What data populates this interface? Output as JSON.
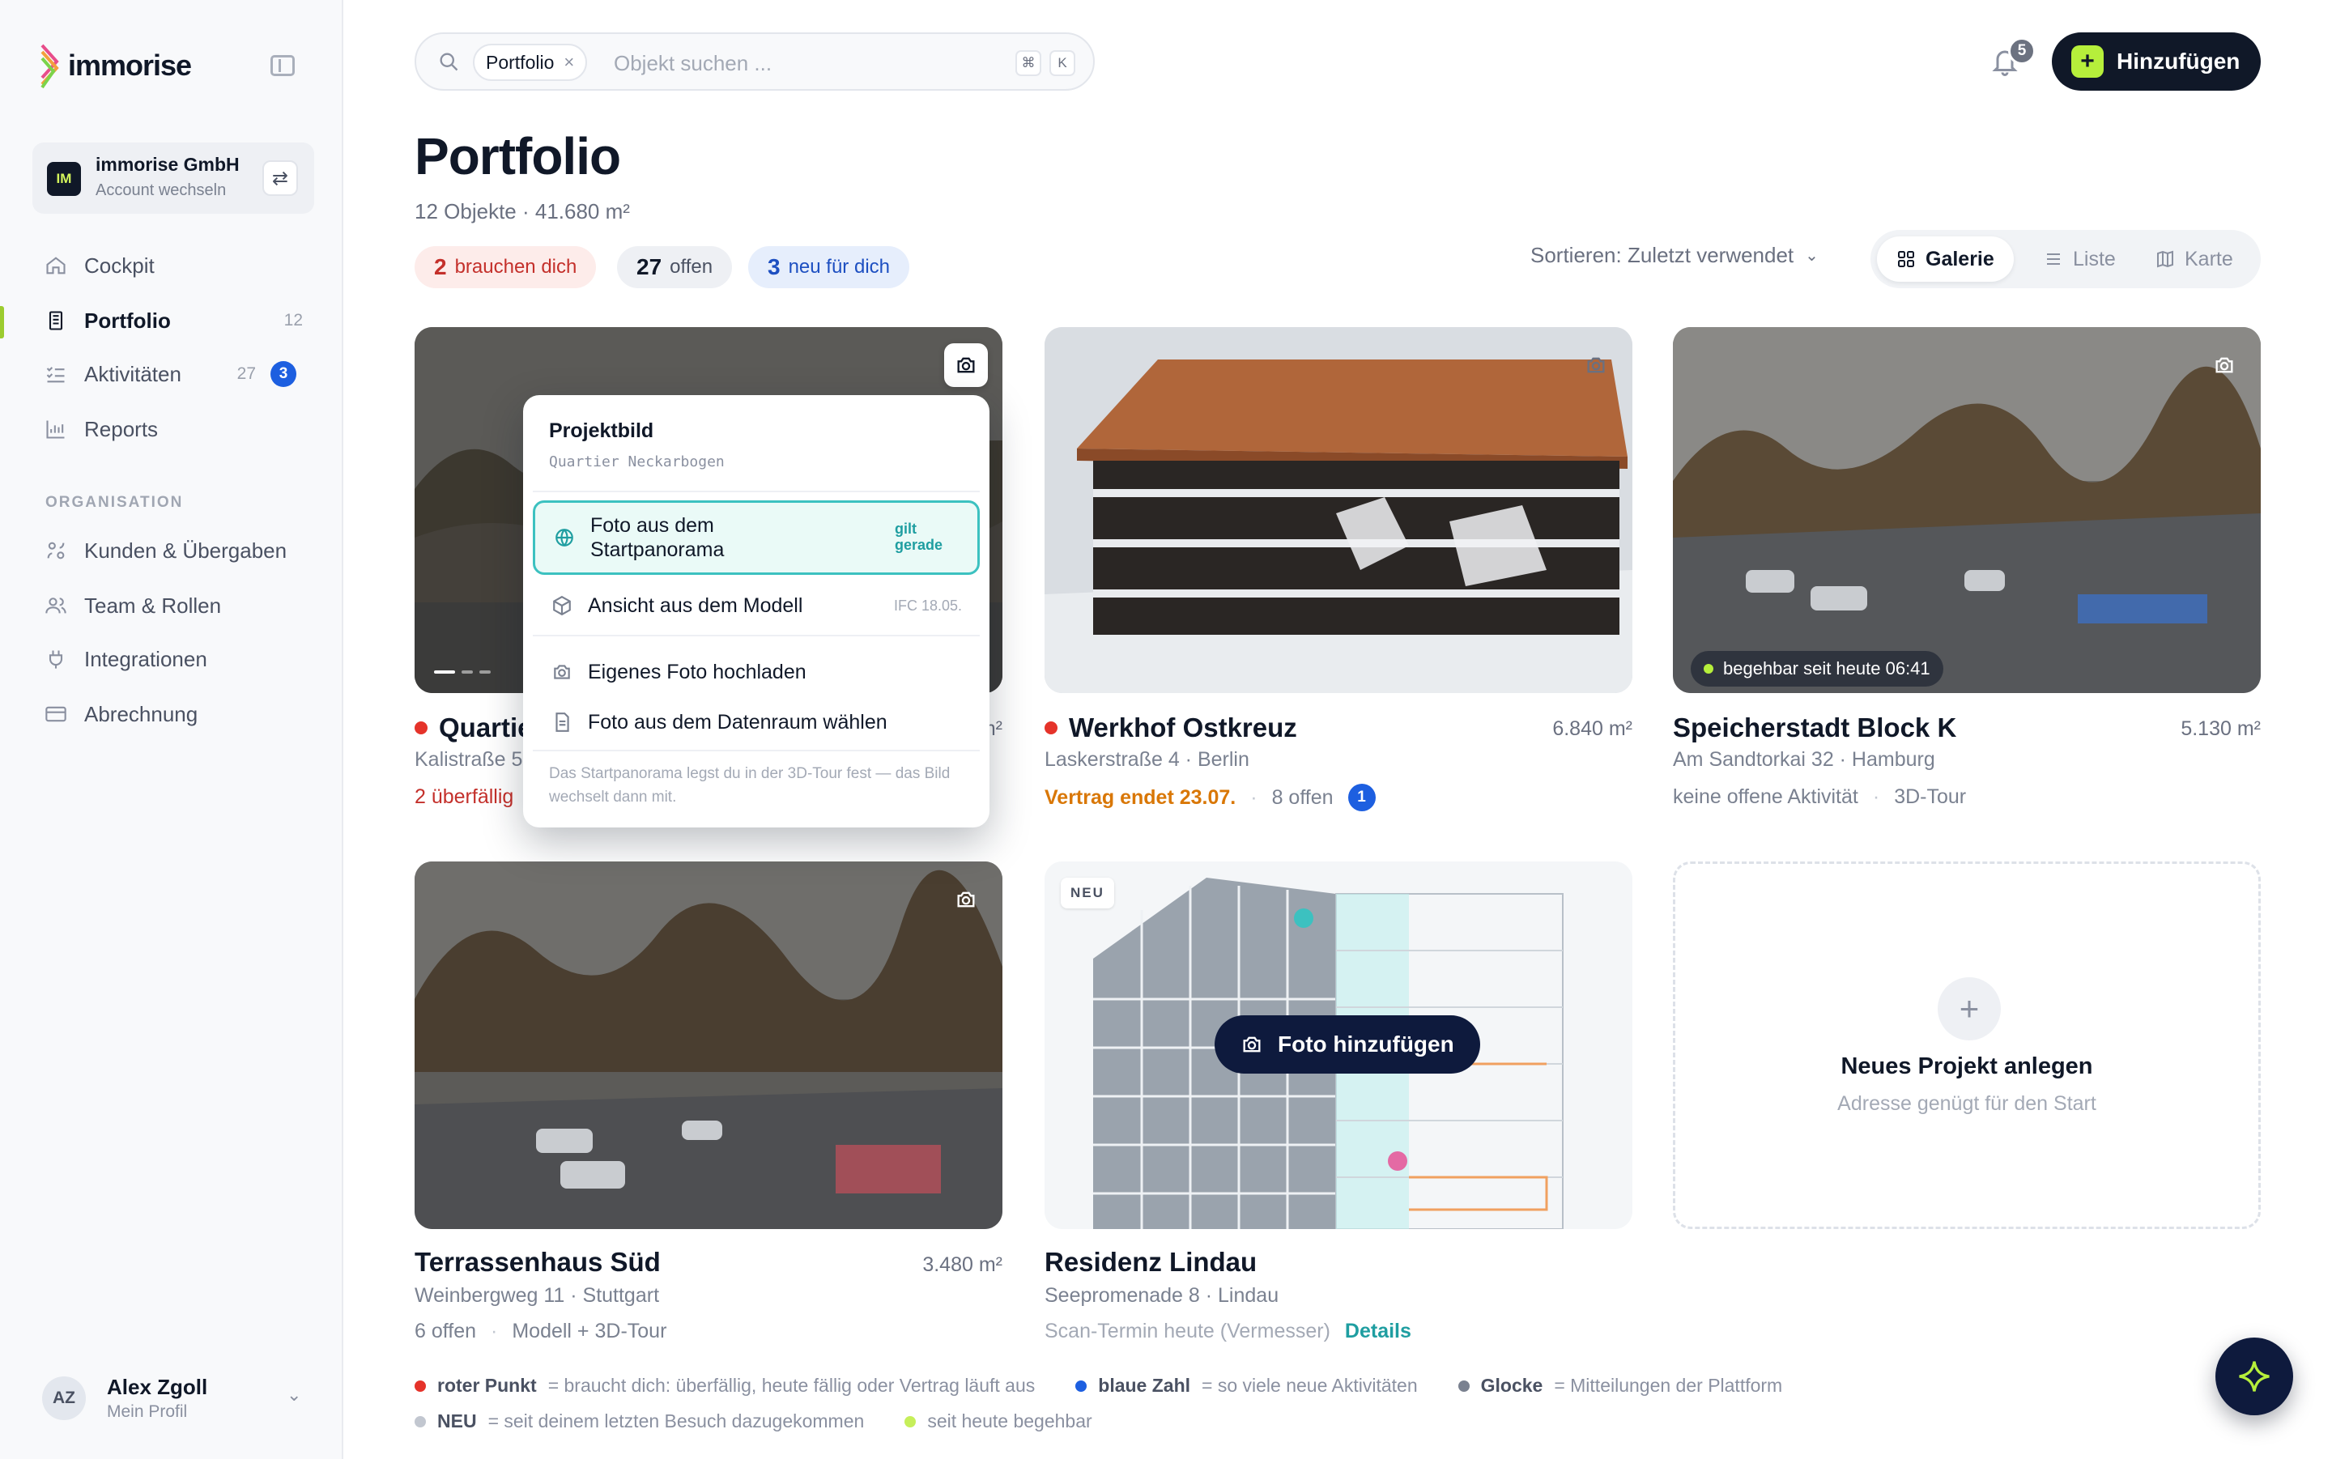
{
  "brand": {
    "name": "immorise"
  },
  "account": {
    "initials": "IM",
    "name": "immorise GmbH",
    "subtitle": "Account wechseln"
  },
  "nav": {
    "items": [
      {
        "label": "Cockpit",
        "icon": "home-icon"
      },
      {
        "label": "Portfolio",
        "icon": "building-icon",
        "count": "12"
      },
      {
        "label": "Aktivitäten",
        "icon": "checklist-icon",
        "count": "27",
        "badge": "3"
      },
      {
        "label": "Reports",
        "icon": "bar-chart-icon"
      }
    ],
    "section_label": "ORGANISATION",
    "org_items": [
      {
        "label": "Kunden & Übergaben",
        "icon": "handover-icon"
      },
      {
        "label": "Team & Rollen",
        "icon": "users-icon"
      },
      {
        "label": "Integrationen",
        "icon": "plug-icon"
      },
      {
        "label": "Abrechnung",
        "icon": "card-icon"
      }
    ]
  },
  "profile": {
    "initials": "AZ",
    "name": "Alex Zgoll",
    "subtitle": "Mein Profil"
  },
  "search": {
    "chip": "Portfolio",
    "placeholder": "Objekt suchen ...",
    "kbd1": "⌘",
    "kbd2": "K"
  },
  "notifications": {
    "count": "5"
  },
  "add_button": {
    "label": "Hinzufügen"
  },
  "header": {
    "title": "Portfolio",
    "subtitle": "12 Objekte · 41.680 m²",
    "pills": [
      {
        "num": "2",
        "text": "brauchen dich"
      },
      {
        "num": "27",
        "text": "offen"
      },
      {
        "num": "3",
        "text": "neu für dich"
      }
    ],
    "sort": "Sortieren: Zuletzt verwendet",
    "views": [
      "Galerie",
      "Liste",
      "Karte"
    ]
  },
  "cards": [
    {
      "title": "Quartie",
      "address": "Kalistraße 5",
      "area": "m²",
      "meta1": "2 überfällig"
    },
    {
      "title": "Werkhof Ostkreuz",
      "address": "Laskerstraße 4 · Berlin",
      "area": "6.840 m²",
      "meta1": "Vertrag endet 23.07.",
      "meta2": "8 offen",
      "badge": "1"
    },
    {
      "title": "Speicherstadt Block K",
      "address": "Am Sandtorkai 32 · Hamburg",
      "area": "5.130 m²",
      "meta1": "keine offene Aktivität",
      "meta2": "3D-Tour",
      "live": "begehbar seit heute 06:41"
    },
    {
      "title": "Terrassenhaus Süd",
      "address": "Weinbergweg 11 · Stuttgart",
      "area": "3.480 m²",
      "meta1": "6 offen",
      "meta2": "Modell + 3D-Tour"
    },
    {
      "title": "Residenz Lindau",
      "address": "Seepromenade 8 · Lindau",
      "meta1": "Scan-Termin heute (Vermesser)",
      "meta2": "Details",
      "tag": "NEU",
      "photo_button": "Foto hinzufügen"
    }
  ],
  "new_project": {
    "title": "Neues Projekt anlegen",
    "subtitle": "Adresse genügt für den Start"
  },
  "popover": {
    "title": "Projektbild",
    "subtitle": "Quartier Neckarbogen",
    "options": [
      {
        "label": "Foto aus dem Startpanorama",
        "meta": "gilt gerade",
        "icon": "panorama-icon"
      },
      {
        "label": "Ansicht aus dem Modell",
        "meta": "IFC 18.05.",
        "icon": "cube-icon"
      },
      {
        "label": "Eigenes Foto hochladen",
        "icon": "camera-icon"
      },
      {
        "label": "Foto aus dem Datenraum wählen",
        "icon": "document-icon"
      }
    ],
    "footer": "Das Startpanorama legst du in der 3D-Tour fest — das Bild wechselt dann mit."
  },
  "legend": {
    "row1": [
      {
        "key": "roter Punkt",
        "text": "= braucht dich: überfällig, heute fällig oder Vertrag läuft aus",
        "color": "#e5332a"
      },
      {
        "key": "blaue Zahl",
        "text": "= so viele neue Aktivitäten",
        "color": "#1d5fe0"
      },
      {
        "key": "Glocke",
        "text": "= Mitteilungen der Plattform",
        "color": "#7a8190"
      }
    ],
    "row2": [
      {
        "key": "NEU",
        "text": "= seit deinem letzten Besuch dazugekommen",
        "color": "#c2c7d0"
      },
      {
        "text": "seit heute begehbar",
        "color": "#c6ef5a"
      }
    ]
  },
  "colors": {
    "accent": "#b6ef3b",
    "dark": "#101828",
    "red": "#e5332a",
    "blue": "#1d5fe0",
    "teal": "#3cc1c0"
  }
}
